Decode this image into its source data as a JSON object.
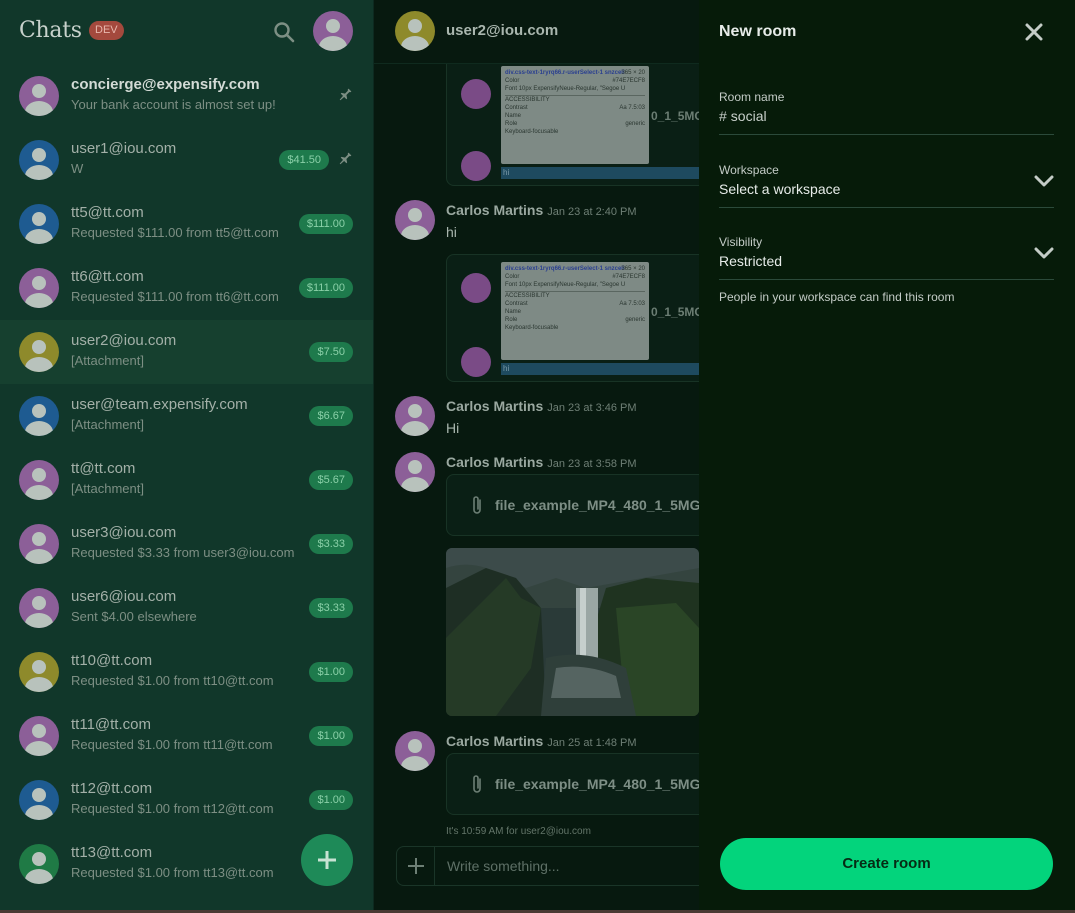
{
  "sidebar": {
    "title": "Chats",
    "badge": "DEV",
    "chats": [
      {
        "name": "concierge@expensify.com",
        "sub": "Your bank account is almost set up!",
        "amount": "",
        "pinned": true,
        "color": "purple",
        "bold": true
      },
      {
        "name": "user1@iou.com",
        "sub": "W",
        "amount": "$41.50",
        "pinned": true,
        "color": "blue"
      },
      {
        "name": "tt5@tt.com",
        "sub": "Requested $111.00 from tt5@tt.com",
        "amount": "$111.00",
        "pinned": false,
        "color": "blue"
      },
      {
        "name": "tt6@tt.com",
        "sub": "Requested $111.00 from tt6@tt.com",
        "amount": "$111.00",
        "pinned": false,
        "color": "purple"
      },
      {
        "name": "user2@iou.com",
        "sub": "[Attachment]",
        "amount": "$7.50",
        "pinned": false,
        "color": "yellow",
        "active": true
      },
      {
        "name": "user@team.expensify.com",
        "sub": "[Attachment]",
        "amount": "$6.67",
        "pinned": false,
        "color": "blue"
      },
      {
        "name": "tt@tt.com",
        "sub": "[Attachment]",
        "amount": "$5.67",
        "pinned": false,
        "color": "purple"
      },
      {
        "name": "user3@iou.com",
        "sub": "Requested $3.33 from user3@iou.com",
        "amount": "$3.33",
        "pinned": false,
        "color": "purple"
      },
      {
        "name": "user6@iou.com",
        "sub": "Sent $4.00 elsewhere",
        "amount": "$3.33",
        "pinned": false,
        "color": "purple"
      },
      {
        "name": "tt10@tt.com",
        "sub": "Requested $1.00 from tt10@tt.com",
        "amount": "$1.00",
        "pinned": false,
        "color": "yellow"
      },
      {
        "name": "tt11@tt.com",
        "sub": "Requested $1.00 from tt11@tt.com",
        "amount": "$1.00",
        "pinned": false,
        "color": "purple"
      },
      {
        "name": "tt12@tt.com",
        "sub": "Requested $1.00 from tt12@tt.com",
        "amount": "$1.00",
        "pinned": false,
        "color": "blue"
      },
      {
        "name": "tt13@tt.com",
        "sub": "Requested $1.00 from tt13@tt.com",
        "amount": "",
        "pinned": false,
        "color": "green"
      }
    ]
  },
  "chat": {
    "title": "user2@iou.com",
    "messages": [
      {
        "author": "Carlos Martins",
        "time": "Jan 23 at 2:40 PM",
        "text": "hi"
      },
      {
        "author": "Carlos Martins",
        "time": "Jan 23 at 3:46 PM",
        "text": "Hi"
      },
      {
        "author": "Carlos Martins",
        "time": "Jan 23 at 3:58 PM",
        "text": ""
      },
      {
        "author": "Carlos Martins",
        "time": "Jan 25 at 1:48 PM",
        "text": ""
      }
    ],
    "file_name": "file_example_MP4_480_1_5MG.mp4",
    "attachment_preview": {
      "selector": "div.css-text-1ryrq66.r-userSelect-1 snzcell",
      "size": "365 × 20",
      "color_label": "Color",
      "color_value": "#74E7ECF8",
      "font_label": "Font",
      "font_value": "10px ExpensifyNeue-Regular, \"Segoe U",
      "section": "ACCESSIBILITY",
      "contrast_label": "Contrast",
      "contrast_value": "Aa 7.5:03",
      "name_label": "Name",
      "role_label": "Role",
      "role_value": "generic",
      "keyboard_label": "Keyboard-focusable",
      "trailing_text": "0_1_5MG.m",
      "bar_text": "hi"
    },
    "status": "It's 10:59 AM for user2@iou.com",
    "composer_placeholder": "Write something..."
  },
  "panel": {
    "title": "New room",
    "room_name_label": "Room name",
    "room_name_prefix": "#",
    "room_name_value": "social",
    "workspace_label": "Workspace",
    "workspace_value": "Select a workspace",
    "visibility_label": "Visibility",
    "visibility_value": "Restricted",
    "hint": "People in your workspace can find this room",
    "create_label": "Create room"
  },
  "colors": {
    "accent": "#03D47C",
    "panel_bg": "#061B09",
    "sidebar_bg": "#11372A"
  }
}
